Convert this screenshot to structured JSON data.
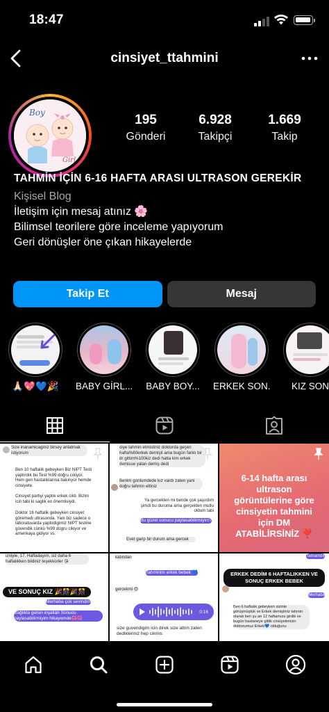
{
  "status_bar": {
    "time": "18:47"
  },
  "header": {
    "username": "cinsiyet_ttahmini"
  },
  "avatar": {
    "text_boy": "Boy",
    "text_girl": "Girl"
  },
  "stats": [
    {
      "value": "195",
      "label": "Gönderi"
    },
    {
      "value": "6.928",
      "label": "Takipçi"
    },
    {
      "value": "1.669",
      "label": "Takip"
    }
  ],
  "bio": {
    "name": "TAHMİN İÇİN 6-16 HAFTA ARASI ULTRASON GEREKİR",
    "category": "Kişisel Blog",
    "lines": [
      "İletişim için mesaj atınız 🌸",
      "Bilimsel teorilere göre inceleme yapıyorum",
      "Geri dönüşler öne çıkan hikayelerde"
    ]
  },
  "actions": {
    "follow": "Takip Et",
    "message": "Mesaj"
  },
  "highlights": [
    {
      "label": "🙏🏻💖💙🎉"
    },
    {
      "label": "BABY GİRL..."
    },
    {
      "label": "BABY BOY..."
    },
    {
      "label": "ERKEK SON..."
    },
    {
      "label": "KIZ SON"
    }
  ],
  "tabs": [
    "grid-icon",
    "reels-icon",
    "tagged-icon"
  ],
  "posts": {
    "p1": {
      "lines": [
        "Size inanamicaginiz birsey anlatmak istiyorum",
        "Ben 10 haftalık gebeyken Biz NIPT Testi yaptırdık bu Test %99 doğru cıkiyor. Hem gen hastalıklarına bakılıyor hemde cinsiyete.",
        "Cinsiyet partiyi yaptık erkek cikti. Bizim icin tabi ki saglik en önemlisiydi.",
        "Doktor 16 haftalik gebeyken cinsiyet göremedi ultrasonda. Yani biz sadece o laboratuvarda yaptirdigimiz NIPT testine güvendik cünkü %99 dogru cikiyor ve amerikaya gidiyor vs."
      ]
    },
    "p2": {
      "lines": [
        "diye tahmin etmistiniz doktorda geçen hafta%80erkek demişti ama bugün farklı bir dr gittim%100kiz dedi hatta kim erkek demisse yalan demiş dedi",
        "Benim gonlumdede kız vardı zaten yani doğru tahmin ettiniz",
        "Ya gercekten mi bende çok şaşırdım şimdi bu duruma ama gerçekten mutlu oldum tabi",
        "Bu güzel sonucu paylasabilirmiyim?",
        "Evet garip bir durum ama gercek"
      ]
    },
    "p3": {
      "text": "6-14 hafta arası ultrason görüntülerine göre cinsiyetin tahmini için DM ATABİLİRSİNİZ ❣️"
    },
    "p4": {
      "lines": [
        "izniyle, 17. Haftadayım, siz daha 6 haftalıkken bildiniz teşekkürler 😘",
        "VE SONUÇ KIZ 🎉🎊🎉🎊",
        "Merhaba çok sevindim",
        "Sağlıkla gelsin inşallah Sonucu paylasabilirmiyim hikayemde💞💞"
      ]
    },
    "p5": {
      "lines": [
        "katından",
        "Tahminim erkek bebek 💙",
        "gercekmi 😍",
        "0:16",
        "size guvendigim icin direk size attim zaten dedikleriniz hep cikmis"
      ]
    },
    "p6": {
      "lines": [
        "Tamamdır",
        "ERKEK DEDİM 6 HAFTALIKKEN VE SONUÇ ERKEK BEBEK",
        "Merhaba",
        "Ben 6 haftalık gebeyken sizinle görüşmüştük ve Erkek demiştiniz tahmin olarak ben şu an 12 haftamıza girdik ve bugün hastaneye gittik cinsiyetimizin doktorumuz Erkek💙 olduğunu"
      ]
    }
  },
  "bottom_nav": [
    "home-icon",
    "search-icon",
    "create-icon",
    "reels-icon",
    "profile-icon"
  ],
  "colors": {
    "accent": "#0095f6",
    "button_dark": "#363636",
    "purple_bubble": "#6a5ae0"
  }
}
